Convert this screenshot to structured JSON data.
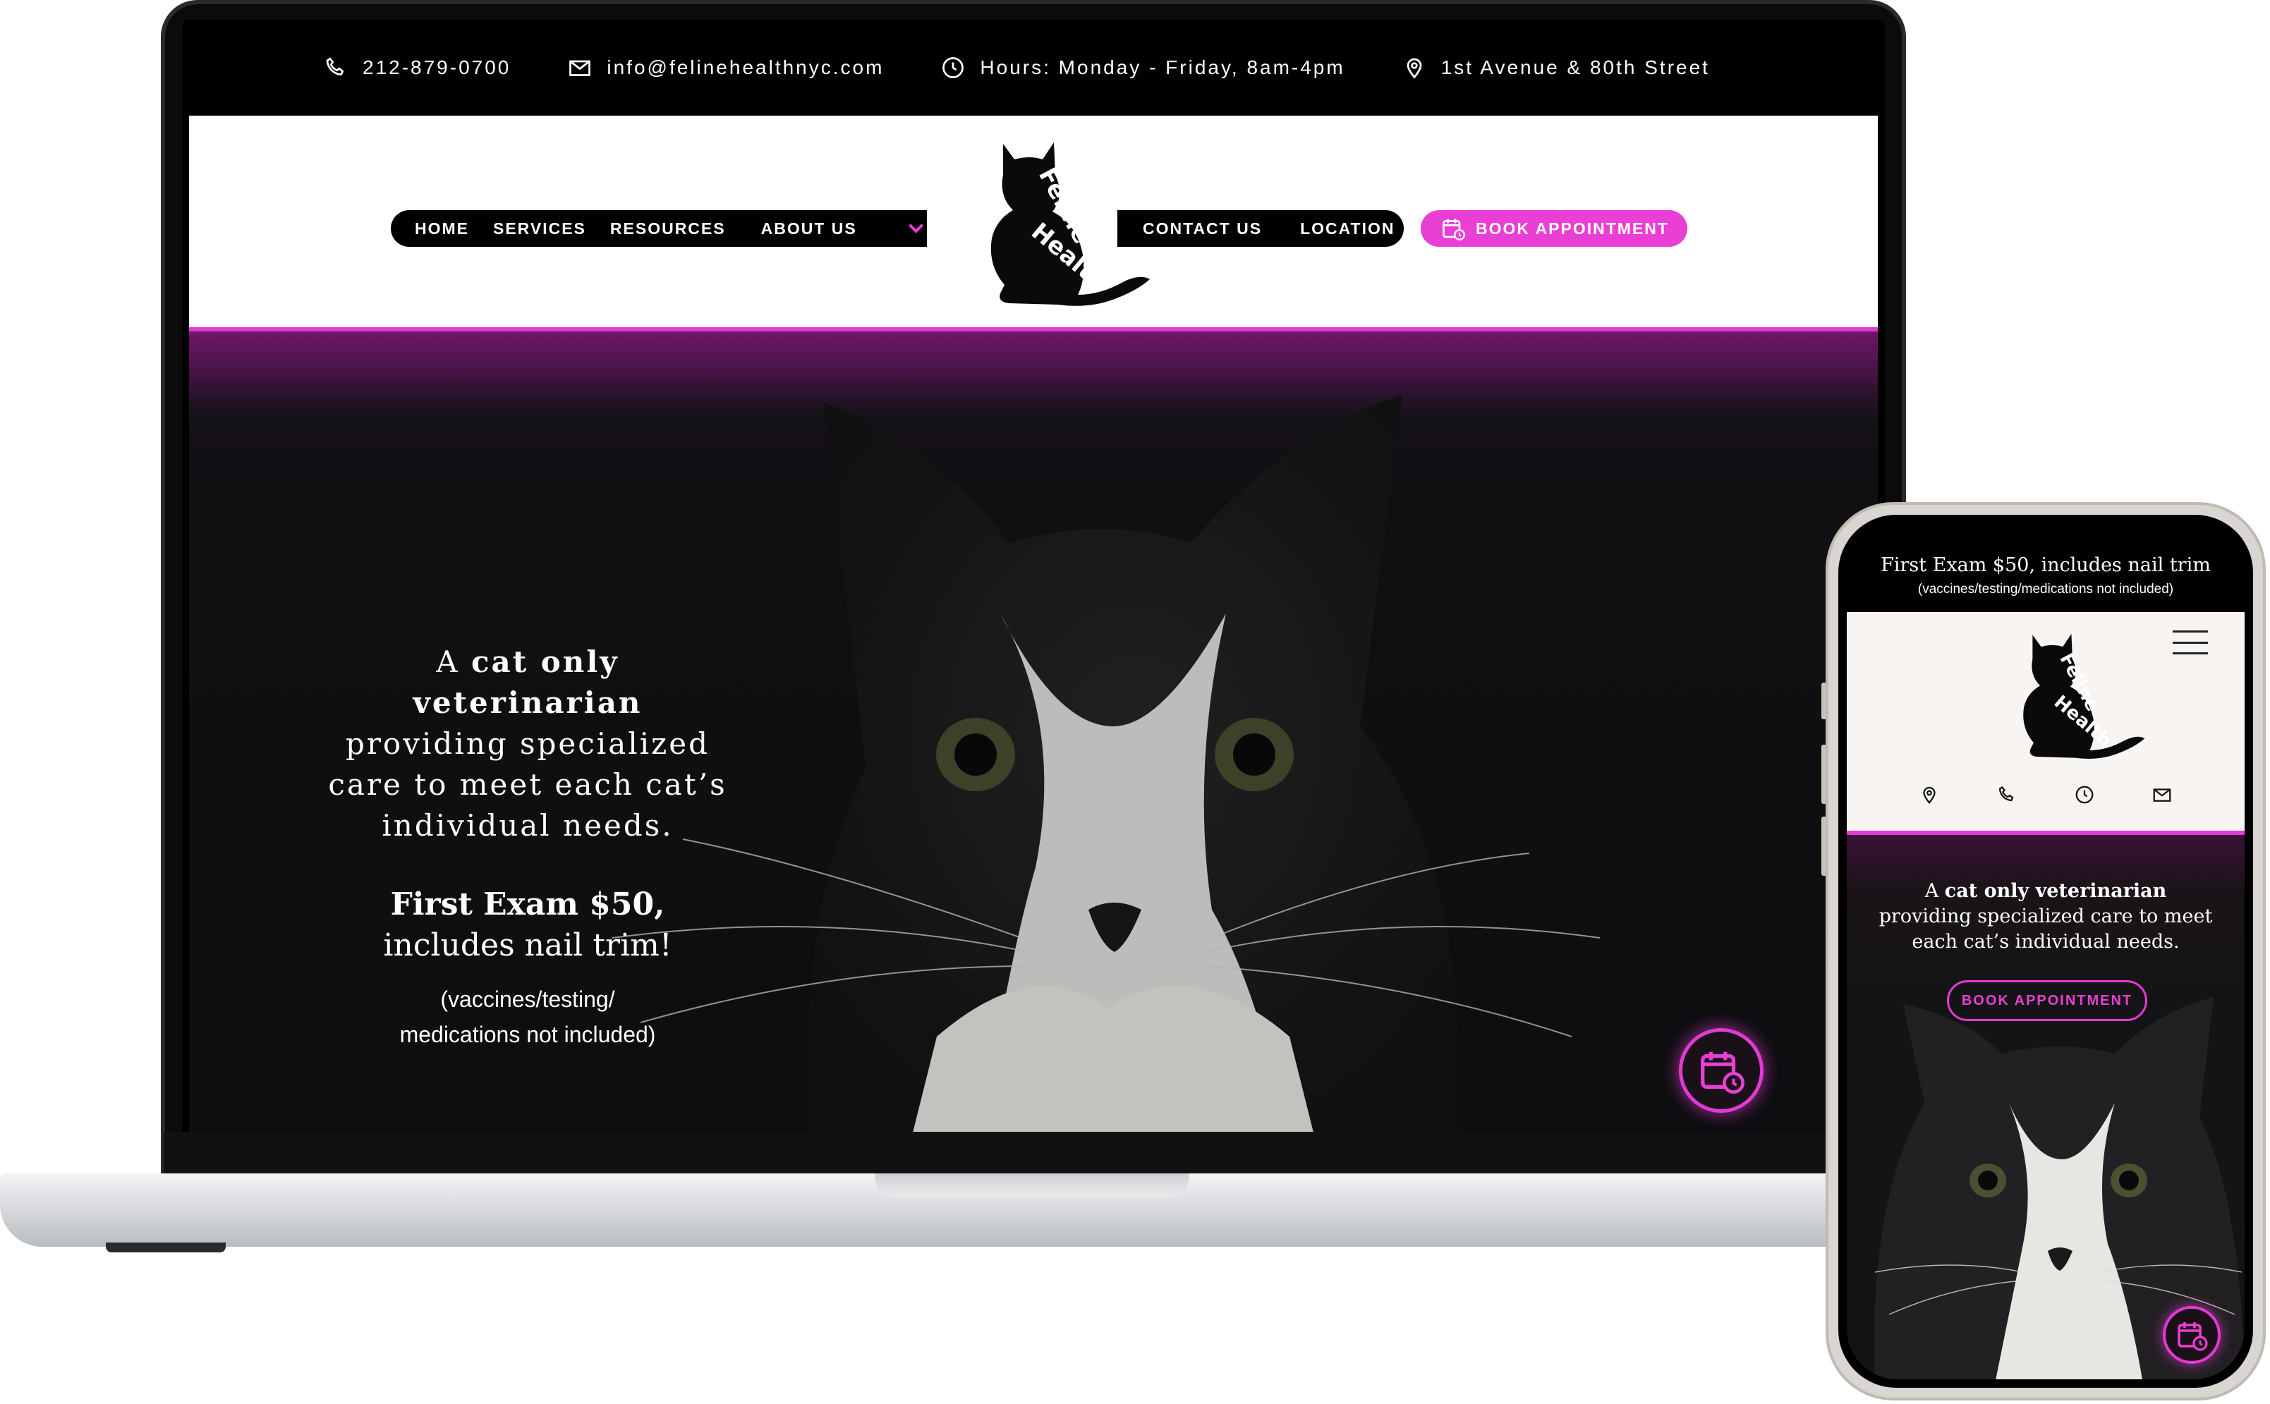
{
  "colors": {
    "accent": "#ea3fd5",
    "bar": "#000000",
    "header_bg": "#ffffff"
  },
  "desktop": {
    "infobar": {
      "phone": "212-879-0700",
      "email": "info@felinehealthnyc.com",
      "hours": "Hours: Monday - Friday, 8am-4pm",
      "location": "1st Avenue & 80th Street"
    },
    "nav": {
      "home": "HOME",
      "services": "SERVICES",
      "resources": "RESOURCES",
      "about": "ABOUT US",
      "contact": "CONTACT US",
      "location": "LOCATION",
      "book": "BOOK APPOINTMENT"
    },
    "logo_text": "Feline Health",
    "hero": {
      "line1_prefix": "A ",
      "line1_bold": "cat only veterinarian",
      "line2": "providing specialized care to meet each cat’s individual needs.",
      "offer_line1": "First Exam $50,",
      "offer_line2": "includes nail trim!",
      "note_line1": "(vaccines/testing/",
      "note_line2": "medications not included)"
    },
    "icons": {
      "phone": "phone-icon",
      "email": "mail-icon",
      "hours": "clock-icon",
      "location": "map-pin-icon",
      "calendar": "calendar-clock-icon",
      "chevron": "chevron-down-icon"
    }
  },
  "mobile": {
    "top_line1": "First Exam $50, includes nail trim",
    "top_line2": "(vaccines/testing/medications not included)",
    "logo_text": "Feline Health",
    "hero_prefix": "A ",
    "hero_bold": "cat only veterinarian",
    "hero_rest": "providing specialized care to meet each cat’s individual needs.",
    "book": "BOOK APPOINTMENT"
  }
}
